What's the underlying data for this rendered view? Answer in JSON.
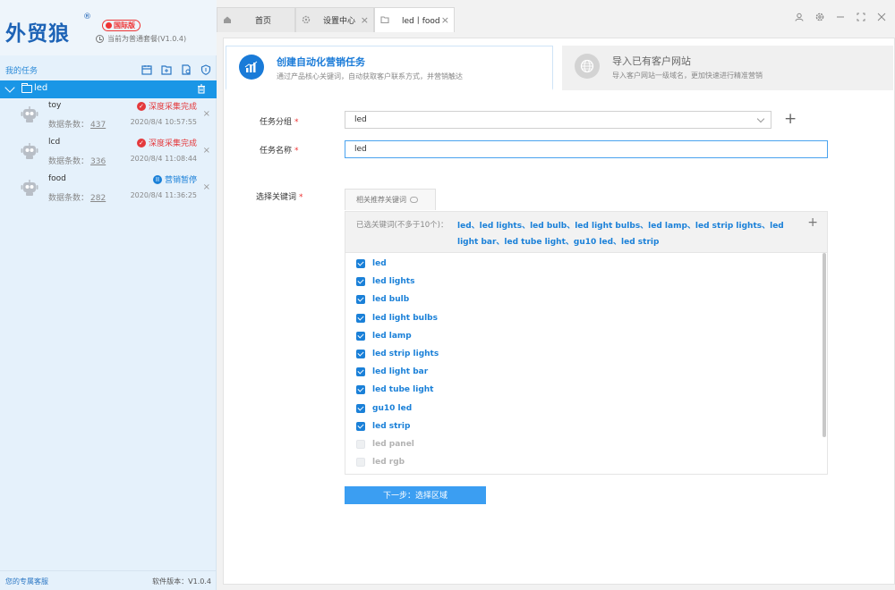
{
  "brand": {
    "logo_text": "外贸狼",
    "reg_mark": "®",
    "edition": "国际版",
    "plan_text": "当前为普通套餐(V1.0.4)"
  },
  "sidebar": {
    "section_title": "我的任务",
    "group": {
      "name": "led"
    },
    "tasks": [
      {
        "name": "toy",
        "count_label": "数据条数：",
        "count": "437",
        "status": "深度采集完成",
        "status_type": "done",
        "time": "2020/8/4 10:57:55"
      },
      {
        "name": "lcd",
        "count_label": "数据条数：",
        "count": "336",
        "status": "深度采集完成",
        "status_type": "done",
        "time": "2020/8/4 11:08:44"
      },
      {
        "name": "food",
        "count_label": "数据条数：",
        "count": "282",
        "status": "营销暂停",
        "status_type": "paused",
        "time": "2020/8/4 11:36:25"
      }
    ],
    "footer_service": "您的专属客服",
    "footer_version": "软件版本：V1.0.4"
  },
  "tabs": [
    {
      "label": "首页",
      "icon": "home-icon"
    },
    {
      "label": "设置中心",
      "icon": "gear-icon"
    },
    {
      "label": "led丨food",
      "icon": "folder-icon"
    }
  ],
  "cards": {
    "create": {
      "title": "创建自动化营销任务",
      "desc": "通过产品核心关键词，自动获取客户联系方式，并营销触达"
    },
    "import": {
      "title": "导入已有客户网站",
      "desc": "导入客户网站一级域名，更加快速进行精准营销"
    }
  },
  "form": {
    "group_label": "任务分组",
    "group_value": "led",
    "name_label": "任务名称",
    "name_value": "led",
    "keyword_label": "选择关键词",
    "required_mark": "*"
  },
  "keywords": {
    "tab_label": "相关推荐关键词",
    "selected_label": "已选关键词(不多于10个)：",
    "selected_values": "led、led lights、led bulb、led light bulbs、led lamp、led strip lights、led light bar、led tube light、gu10 led、led strip",
    "items": [
      {
        "label": "led",
        "checked": true
      },
      {
        "label": "led lights",
        "checked": true
      },
      {
        "label": "led bulb",
        "checked": true
      },
      {
        "label": "led light bulbs",
        "checked": true
      },
      {
        "label": "led lamp",
        "checked": true
      },
      {
        "label": "led strip lights",
        "checked": true
      },
      {
        "label": "led light bar",
        "checked": true
      },
      {
        "label": "led tube light",
        "checked": true
      },
      {
        "label": "gu10 led",
        "checked": true
      },
      {
        "label": "led strip",
        "checked": true
      },
      {
        "label": "led panel",
        "checked": false
      },
      {
        "label": "led rgb",
        "checked": false
      }
    ]
  },
  "next_button": "下一步：选择区域",
  "colors": {
    "accent": "#1a96e6",
    "link": "#1a80d8",
    "danger": "#e4393c"
  }
}
